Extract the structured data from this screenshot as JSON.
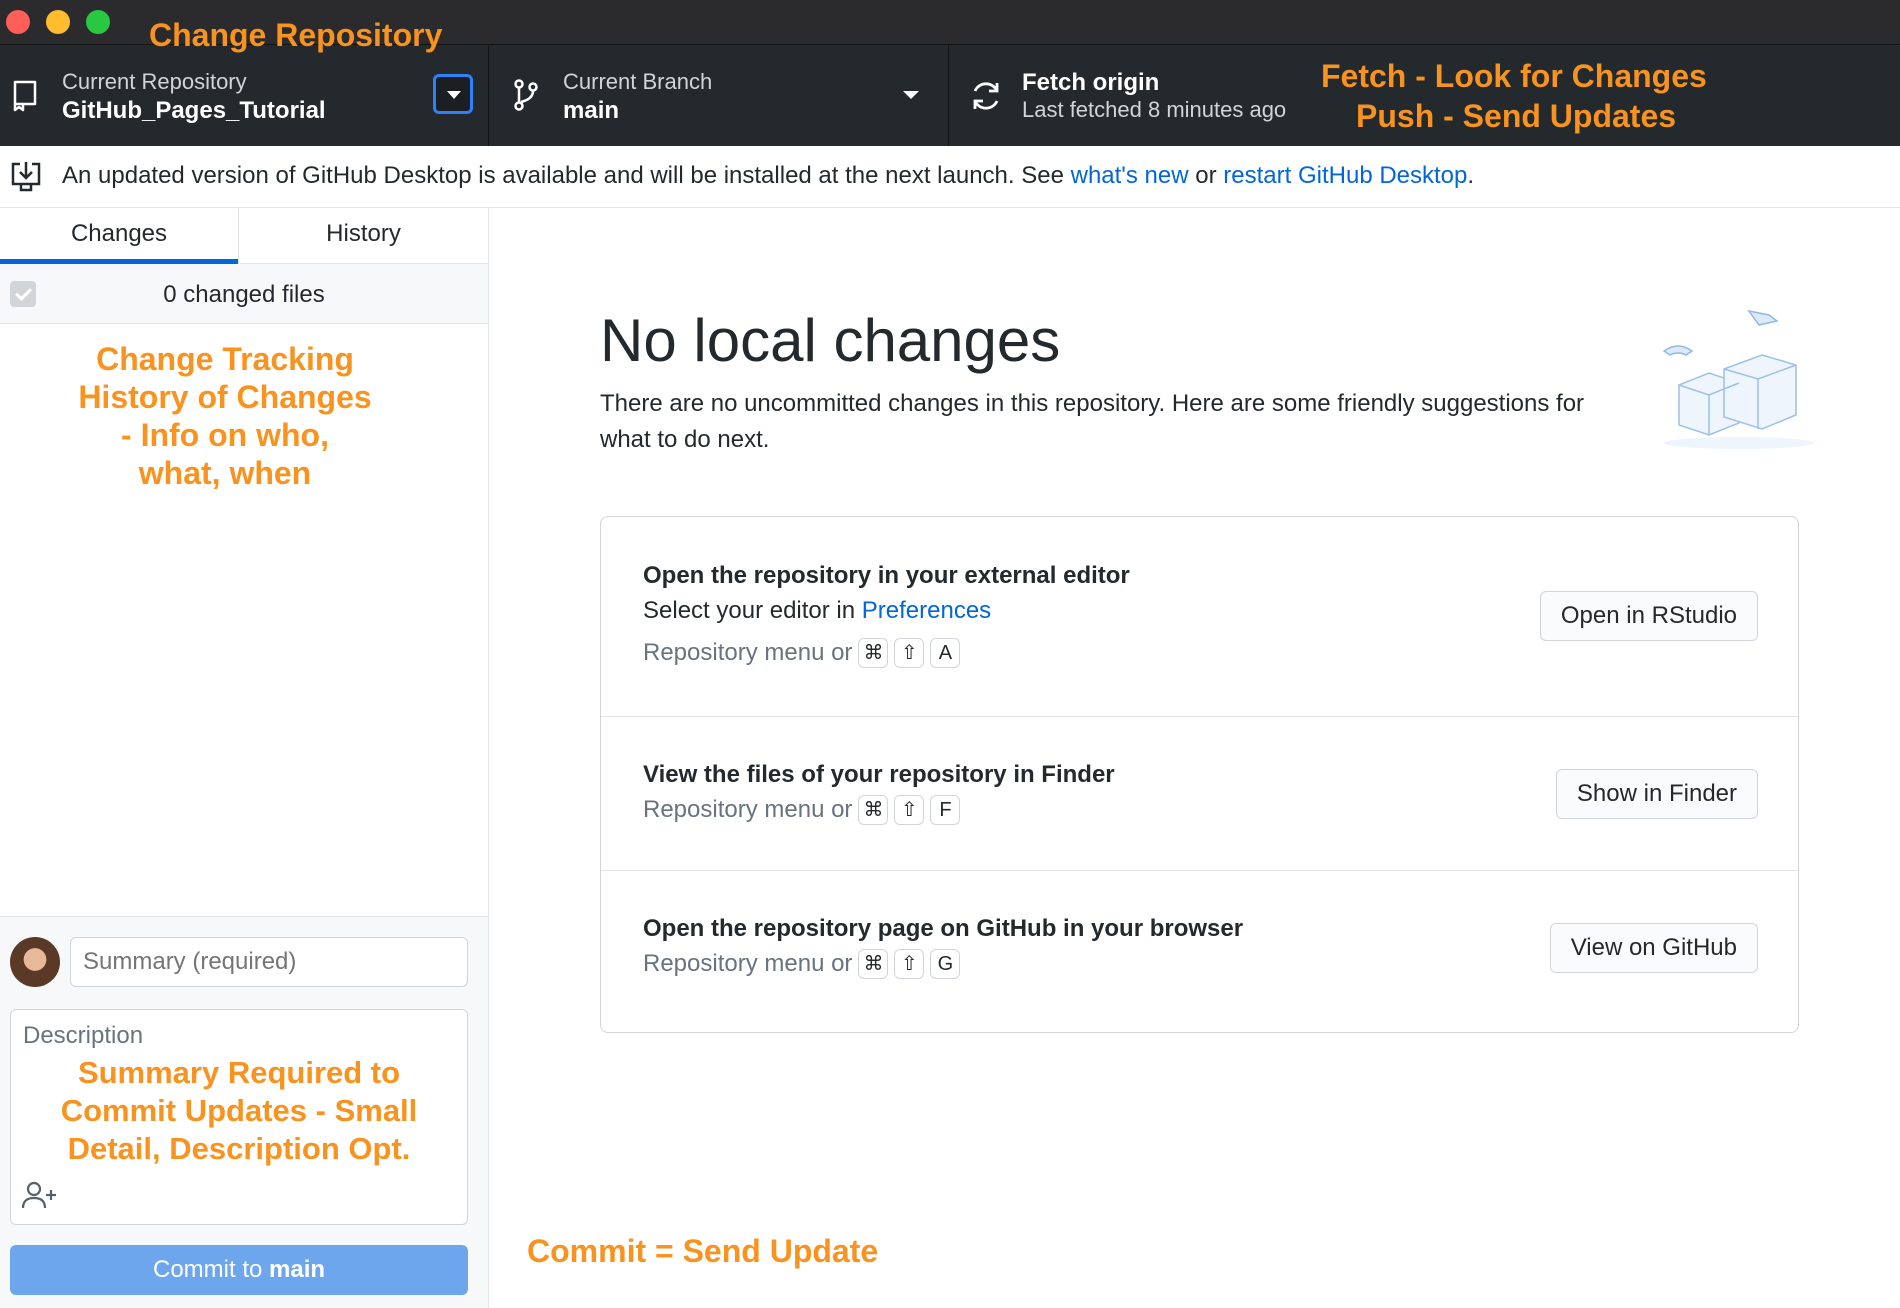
{
  "toolbar": {
    "repo_label": "Current Repository",
    "repo_value": "GitHub_Pages_Tutorial",
    "branch_label": "Current Branch",
    "branch_value": "main",
    "fetch_title": "Fetch origin",
    "fetch_sub": "Last fetched 8 minutes ago"
  },
  "banner": {
    "text_before": "An updated version of GitHub Desktop is available and will be installed at the next launch. See ",
    "link1": "what's new",
    "text_mid": " or ",
    "link2": "restart GitHub Desktop",
    "text_after": "."
  },
  "sidebar": {
    "tabs": [
      "Changes",
      "History"
    ],
    "changed_files": "0 changed files",
    "summary_placeholder": "Summary (required)",
    "description_placeholder": "Description",
    "commit_prefix": "Commit to ",
    "commit_branch": "main"
  },
  "main": {
    "title": "No local changes",
    "description": "There are no uncommitted changes in this repository. Here are some friendly suggestions for what to do next.",
    "rows": [
      {
        "title": "Open the repository in your external editor",
        "sub_prefix": "Select your editor in ",
        "sub_link": "Preferences",
        "hint": "Repository menu or",
        "keys": [
          "⌘",
          "⇧",
          "A"
        ],
        "button": "Open in RStudio"
      },
      {
        "title": "View the files of your repository in Finder",
        "hint": "Repository menu or",
        "keys": [
          "⌘",
          "⇧",
          "F"
        ],
        "button": "Show in Finder"
      },
      {
        "title": "Open the repository page on GitHub in your browser",
        "hint": "Repository menu or",
        "keys": [
          "⌘",
          "⇧",
          "G"
        ],
        "button": "View on GitHub"
      }
    ]
  },
  "annotations": {
    "change_repo": "Change Repository",
    "fetch_line1": "Fetch - Look for Changes",
    "fetch_line2": "Push - Send Updates",
    "tracking_line1": "Change Tracking",
    "tracking_line2": "History of Changes",
    "tracking_line3": "- Info on who,",
    "tracking_line4": "what, when",
    "summary_line1": "Summary Required to",
    "summary_line2": "Commit Updates - Small",
    "summary_line3": "Detail, Description Opt.",
    "commit_note": "Commit = Send Update"
  },
  "colors": {
    "accent": "#0366d6",
    "annotation": "#f7931e",
    "toolbar_bg": "#24292e",
    "commit_button": "#6ea6ee"
  }
}
